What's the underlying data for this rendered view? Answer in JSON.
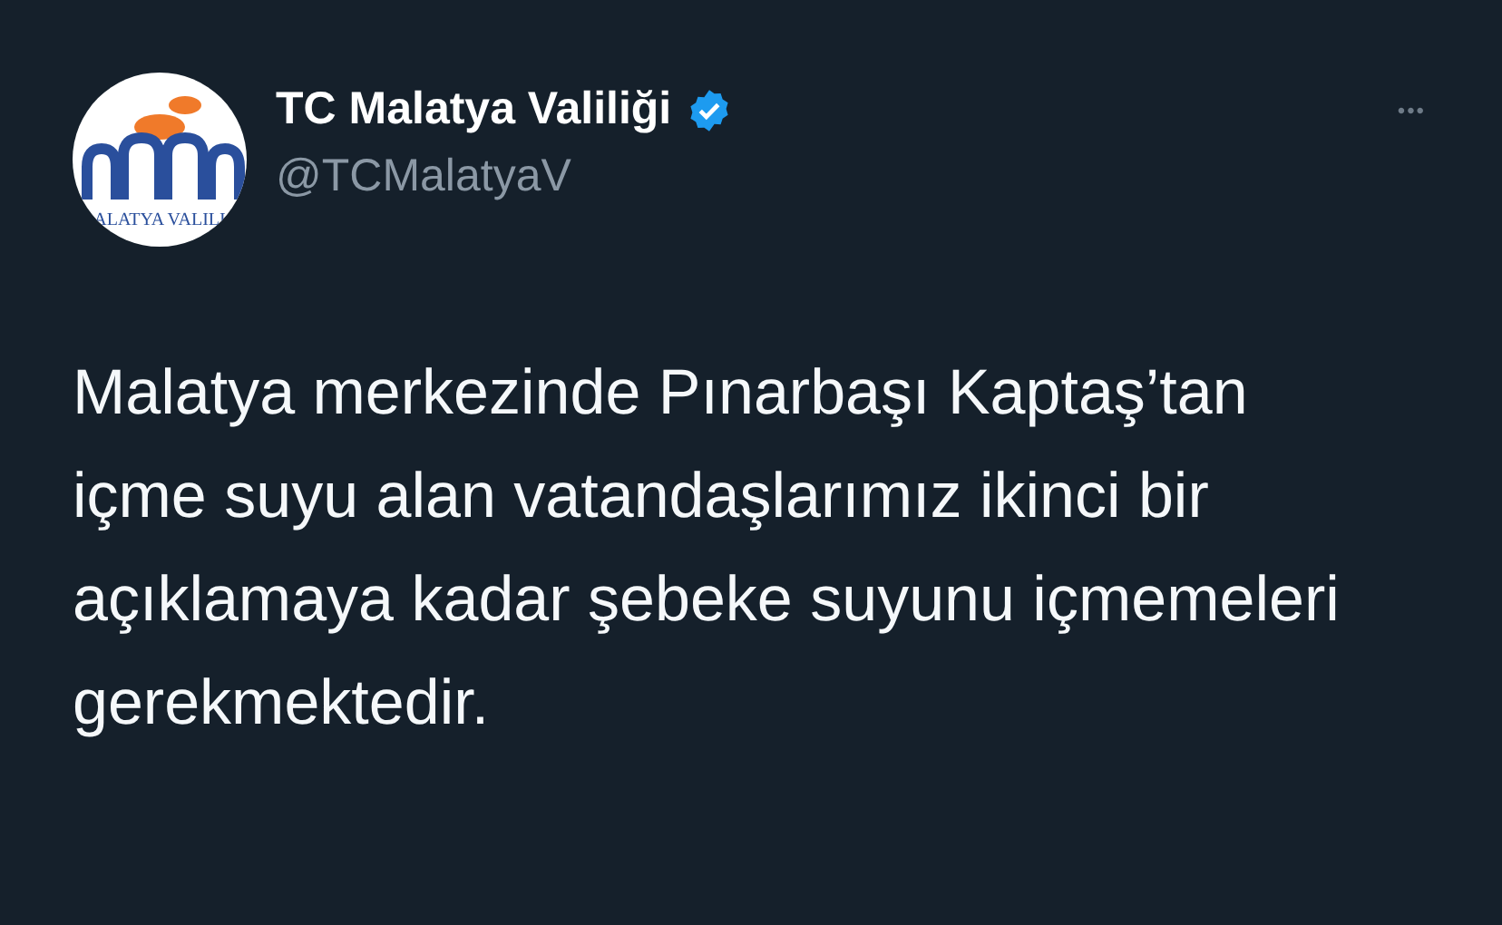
{
  "author": {
    "name": "TC Malatya Valiliği",
    "verified": true,
    "handle": "@TCMalatyaV",
    "logo_text": "ALATYA VALILI"
  },
  "more_button": "•••",
  "body": "Malatya merkezinde Pınarbaşı Kaptaş’tan içme suyu alan vatandaşlarımız ikinci bir açıklamaya kadar şebeke suyunu içmemeleri gerekmektedir."
}
